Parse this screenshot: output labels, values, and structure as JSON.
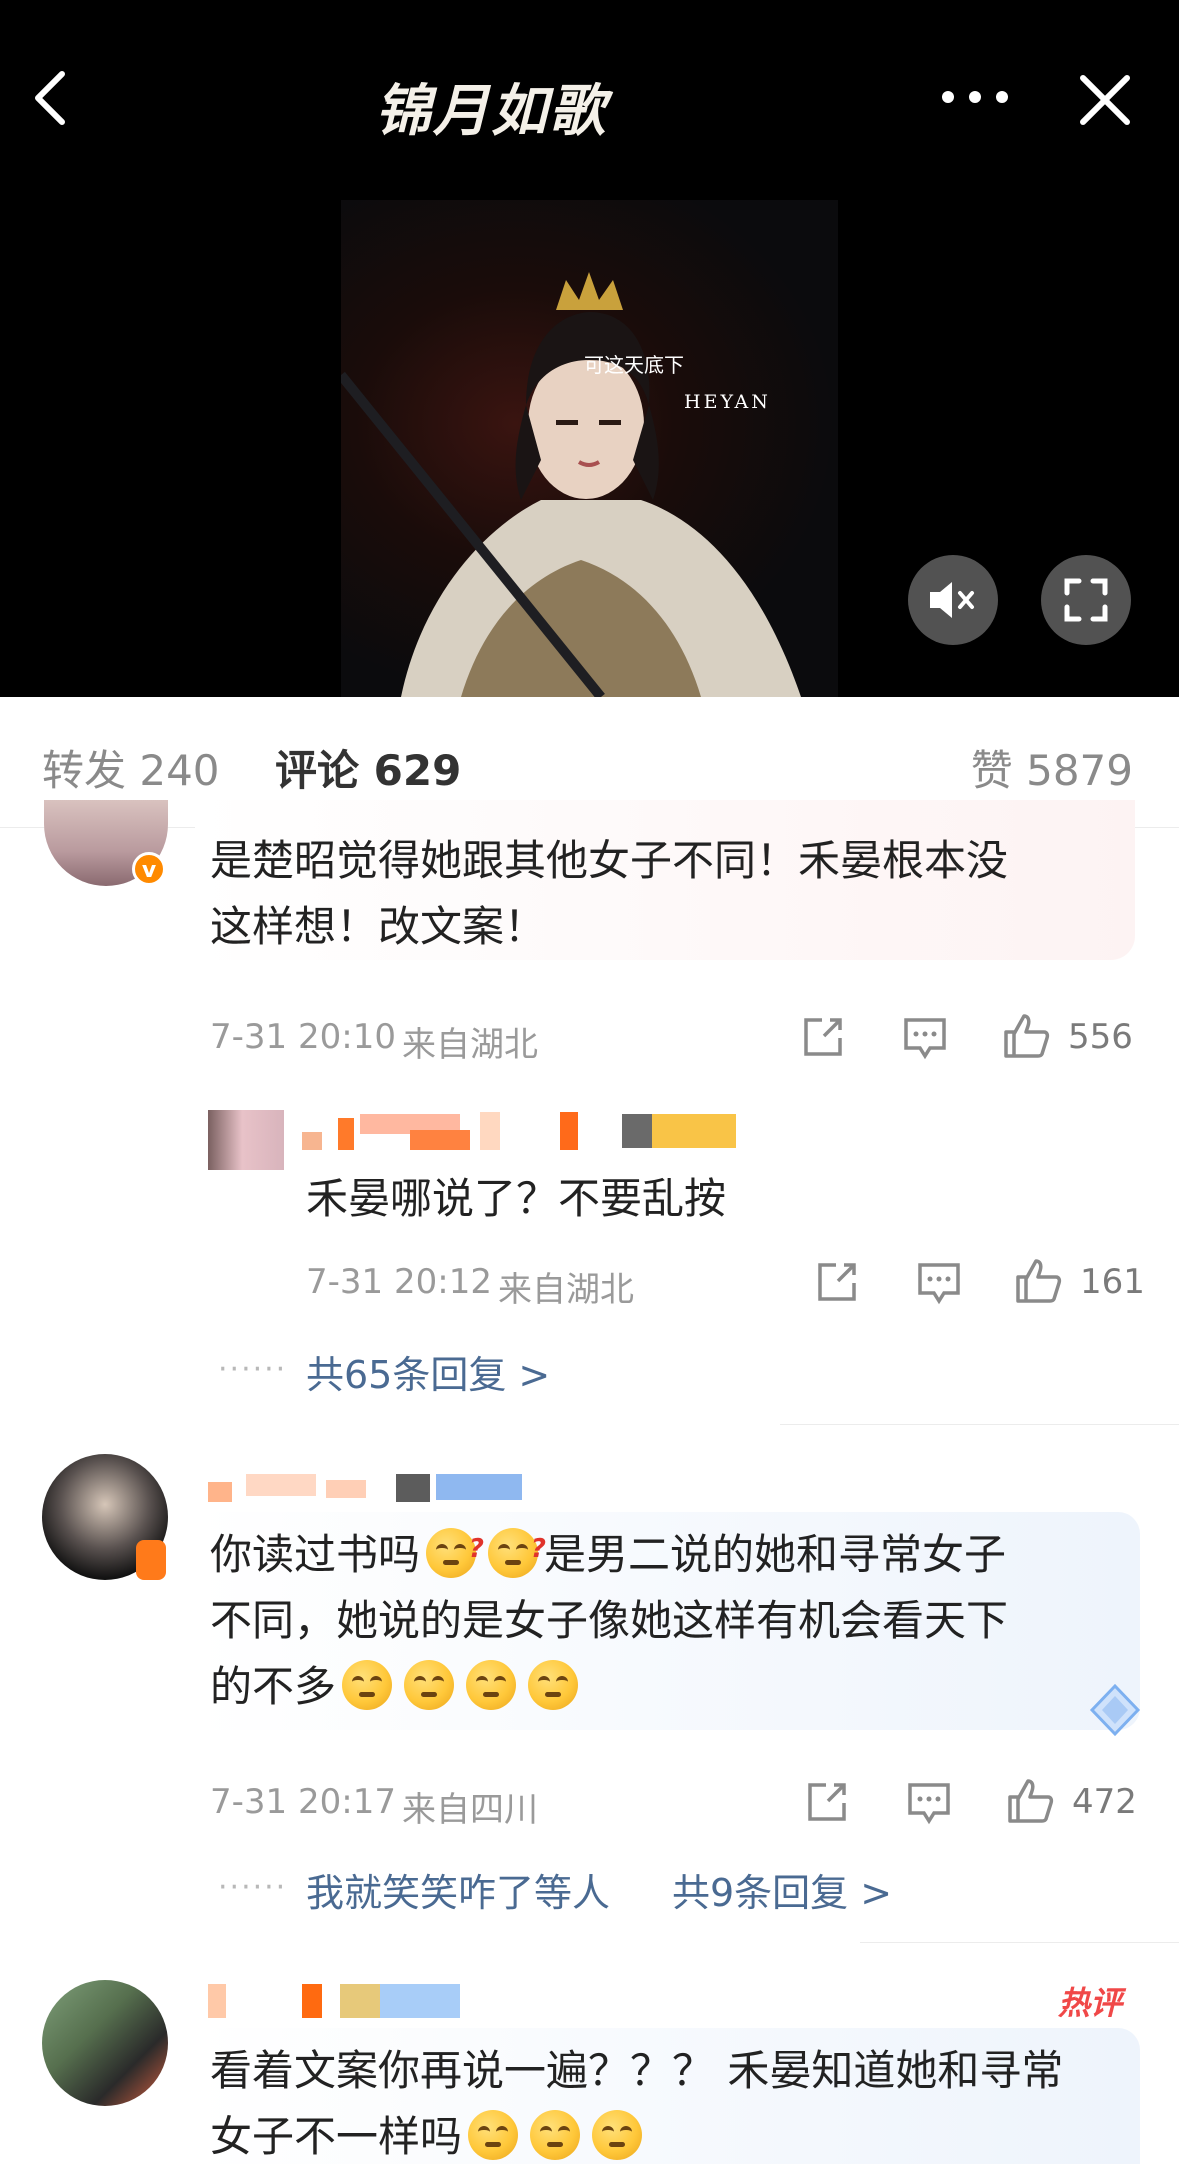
{
  "header": {
    "logo_text": "锦月如歌",
    "subtitle_line1": "可这天底下",
    "subtitle_line2": "HEYAN"
  },
  "tabs": {
    "repost": "转发 240",
    "comment": "评论 629",
    "like": "赞 5879"
  },
  "comments": [
    {
      "text_lines": [
        "是楚昭觉得她跟其他女子不同！禾晏根本没",
        "这样想！改文案！"
      ],
      "time": "7-31 20:10",
      "location": "来自湖北",
      "likes": "556",
      "reply": {
        "text": "禾晏哪说了？不要乱按",
        "time": "7-31 20:12",
        "location": "来自湖北",
        "likes": "161"
      },
      "more_replies": "共65条回复 >"
    },
    {
      "text_line1": "你读过书吗",
      "text_line1b": "是男二说的她和寻常女子",
      "text_line2": "不同，她说的是女子像她这样有机会看天下",
      "text_line3": "的不多",
      "time": "7-31 20:17",
      "location": "来自四川",
      "likes": "472",
      "reply_preview": "我就笑笑咋了等人",
      "more_replies": "共9条回复 >"
    },
    {
      "badge": "热评",
      "text_line1": "看着文案你再说一遍？？？ 禾晏知道她和寻常",
      "text_line2": "女子不一样吗"
    }
  ],
  "colors": {
    "accent": "#ff8200",
    "link": "#4a6a92",
    "hot": "#f04848"
  }
}
